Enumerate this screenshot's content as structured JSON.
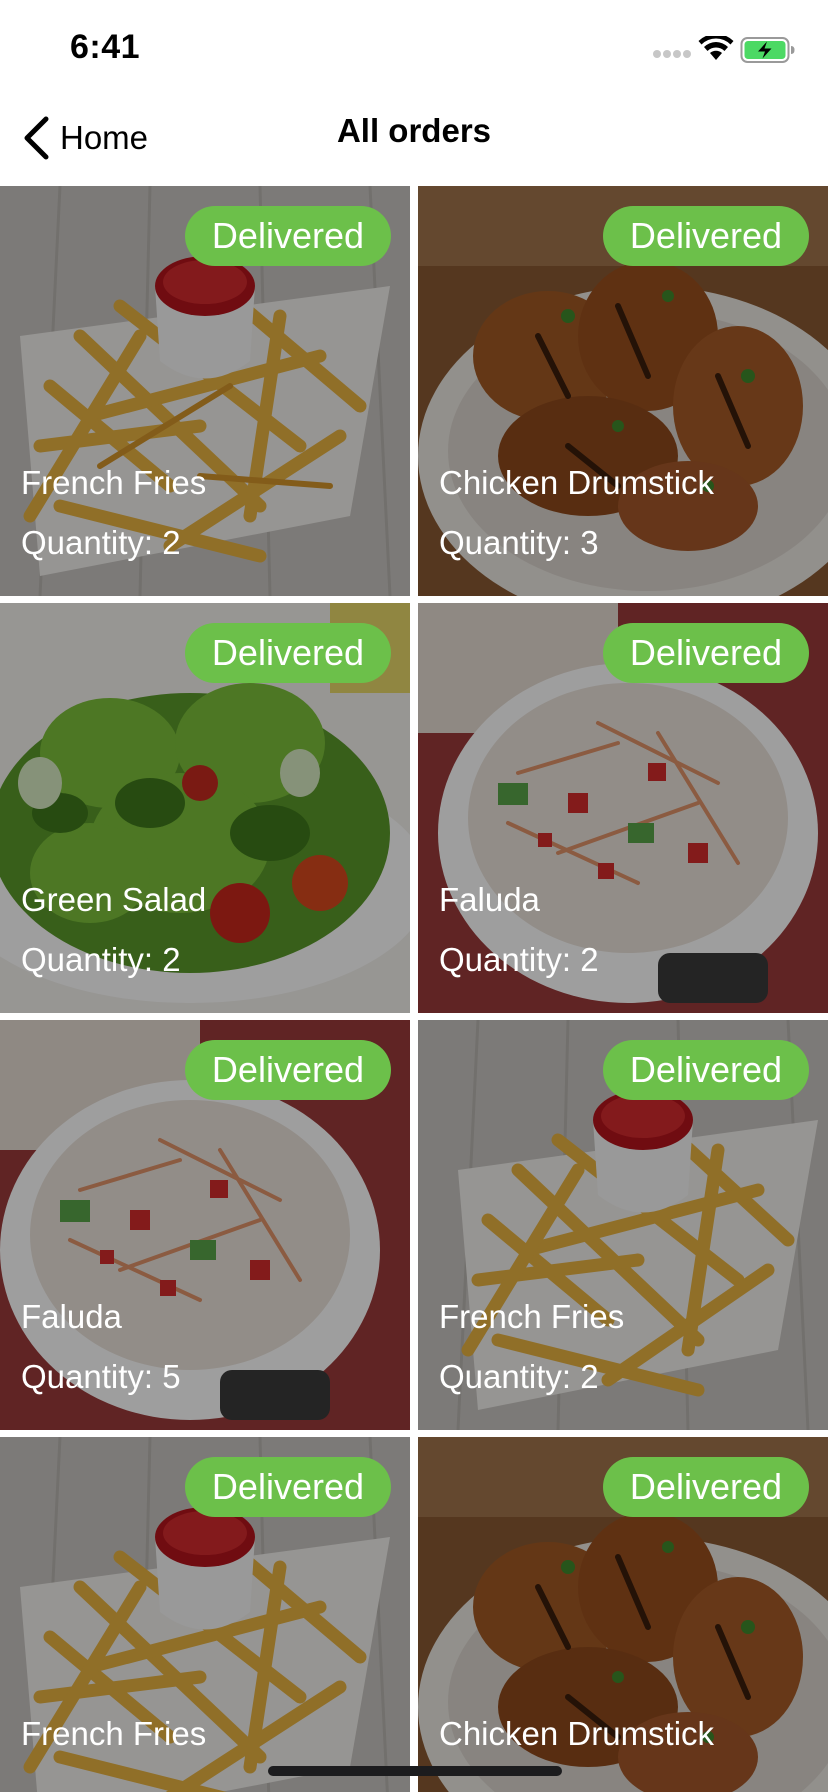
{
  "status_bar": {
    "time": "6:41"
  },
  "nav": {
    "back_label": "Home",
    "title": "All orders"
  },
  "orders": [
    {
      "name": "French Fries",
      "quantity": "Quantity: 2",
      "status": "Delivered",
      "image": "french-fries"
    },
    {
      "name": "Chicken Drumstick",
      "quantity": "Quantity: 3",
      "status": "Delivered",
      "image": "chicken-drumstick"
    },
    {
      "name": "Green Salad",
      "quantity": "Quantity: 2",
      "status": "Delivered",
      "image": "green-salad"
    },
    {
      "name": "Faluda",
      "quantity": "Quantity: 2",
      "status": "Delivered",
      "image": "faluda"
    },
    {
      "name": "Faluda",
      "quantity": "Quantity: 5",
      "status": "Delivered",
      "image": "faluda"
    },
    {
      "name": "French Fries",
      "quantity": "Quantity: 2",
      "status": "Delivered",
      "image": "french-fries"
    },
    {
      "name": "French Fries",
      "quantity": "",
      "status": "Delivered",
      "image": "french-fries"
    },
    {
      "name": "Chicken Drumstick",
      "quantity": "",
      "status": "Delivered",
      "image": "chicken-drumstick"
    }
  ],
  "colors": {
    "badge": "#6cc04a",
    "overlay": "rgba(0,0,0,0.38)",
    "battery": "#4cd964"
  }
}
